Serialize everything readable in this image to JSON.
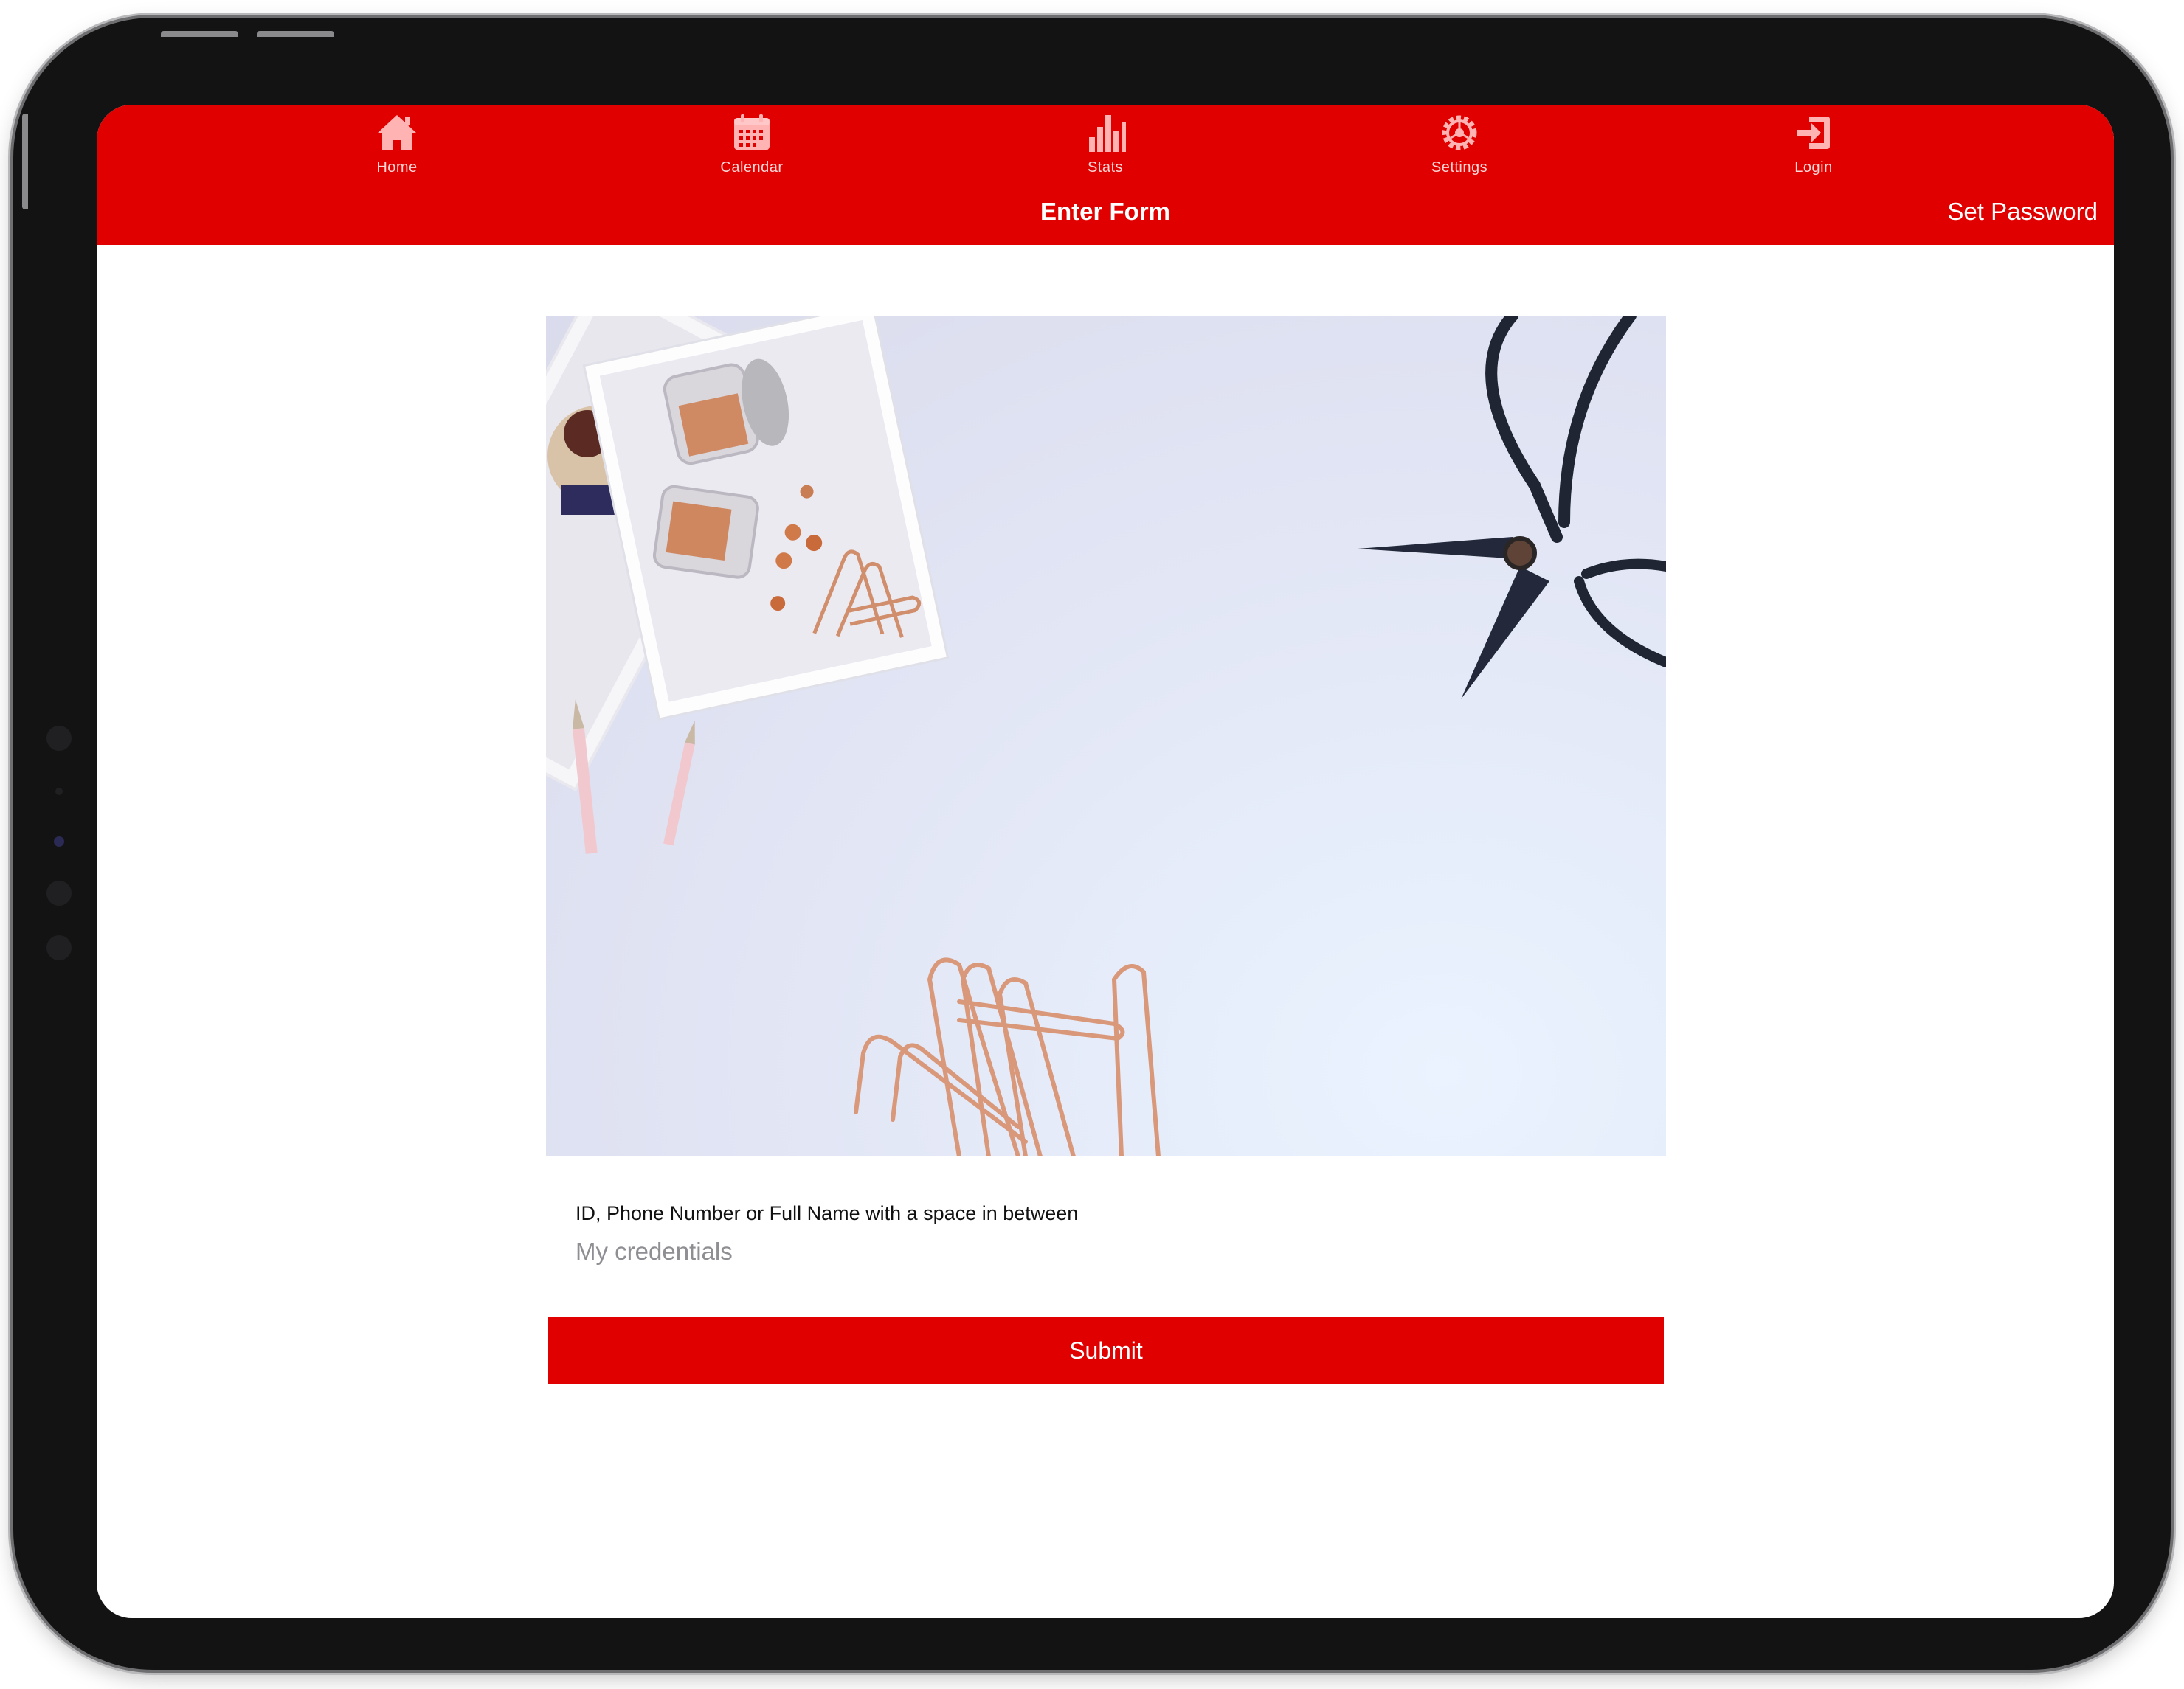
{
  "tabs": [
    {
      "label": "Home",
      "icon": "home-icon"
    },
    {
      "label": "Calendar",
      "icon": "calendar-icon"
    },
    {
      "label": "Stats",
      "icon": "stats-icon"
    },
    {
      "label": "Settings",
      "icon": "settings-icon"
    },
    {
      "label": "Login",
      "icon": "login-icon"
    }
  ],
  "nav": {
    "title": "Enter Form",
    "action": "Set Password"
  },
  "form": {
    "field_label": "ID, Phone Number or Full Name with a space in between",
    "placeholder": "My credentials",
    "submit_label": "Submit"
  },
  "colors": {
    "accent": "#e10000",
    "tab_icon": "#ffb3b3",
    "background": "#ffffff"
  }
}
